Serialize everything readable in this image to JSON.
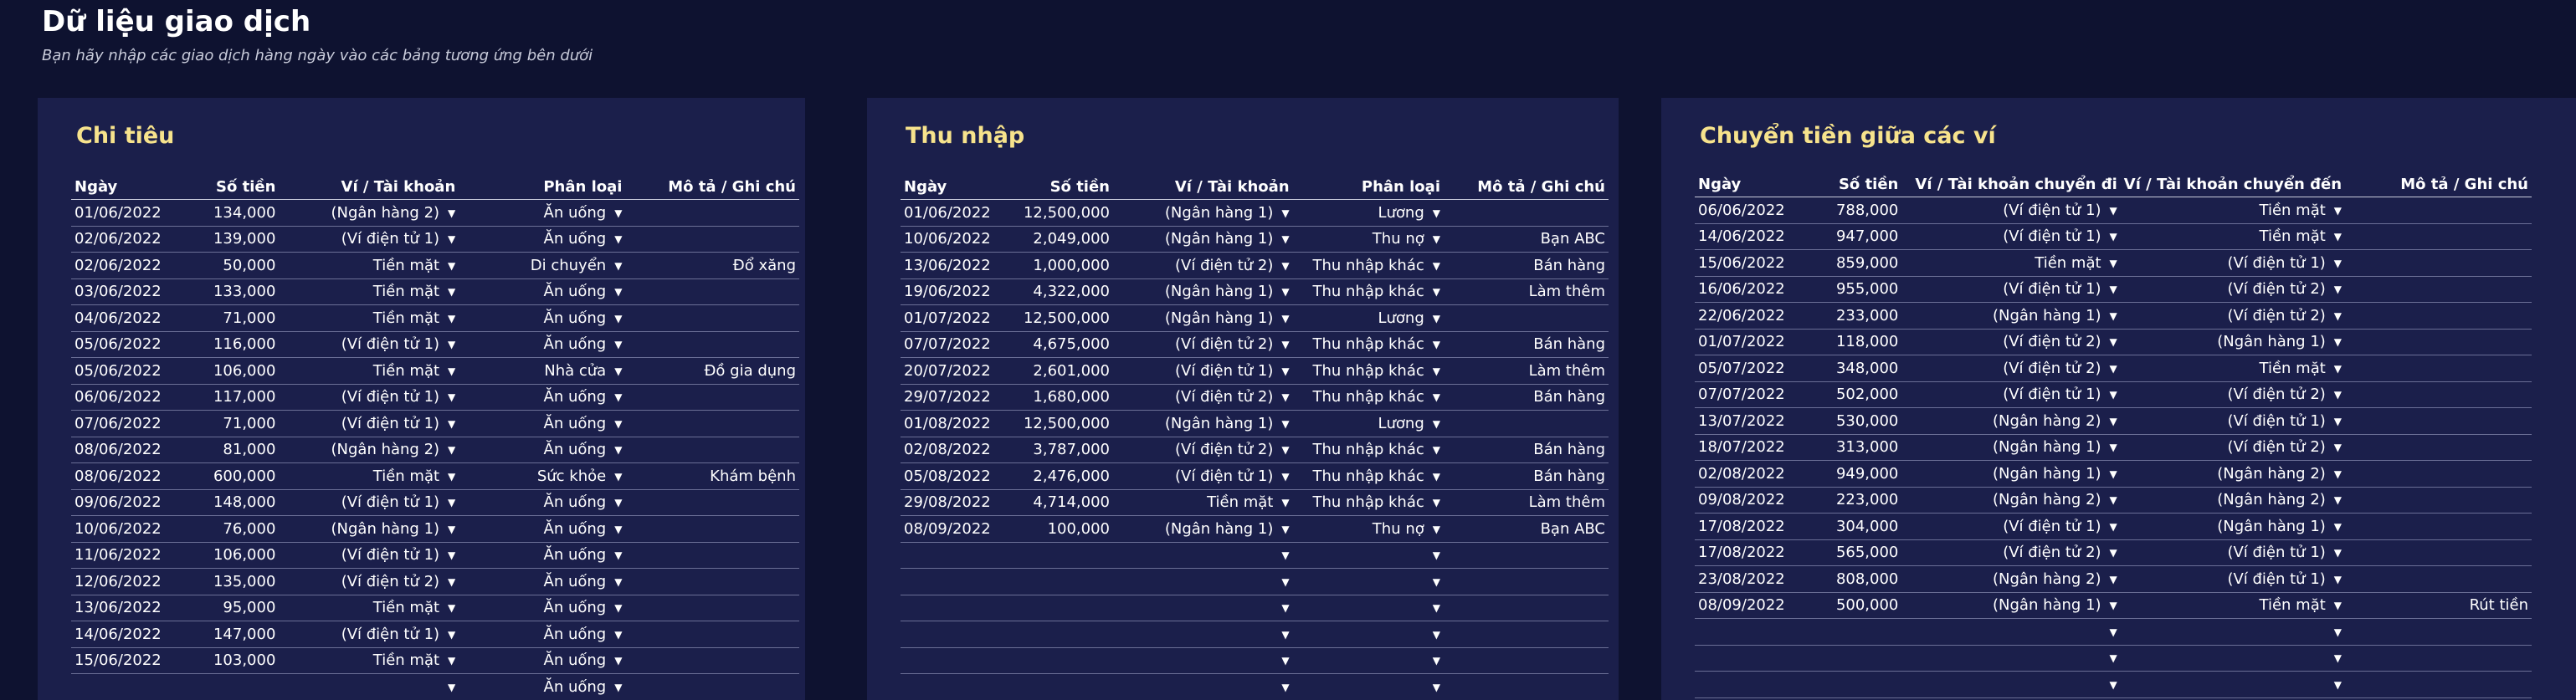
{
  "page": {
    "title": "Dữ liệu giao dịch",
    "subtitle": "Bạn hãy nhập các giao dịch hàng ngày vào các bảng tương ứng bên dưới"
  },
  "icons": {
    "dropdown": "chevron-down-icon"
  },
  "colors": {
    "background": "#0e1230",
    "panel": "#1b1f4b",
    "panel_title": "#f7e38c"
  },
  "expense": {
    "title": "Chi tiêu",
    "headers": [
      "Ngày",
      "Số tiền",
      "Ví / Tài khoản",
      "Phân loại",
      "Mô tả / Ghi chú"
    ],
    "rows": [
      [
        "01/06/2022",
        "134,000",
        "(Ngân hàng 2)",
        "Ăn uống",
        ""
      ],
      [
        "02/06/2022",
        "139,000",
        "(Ví điện tử 1)",
        "Ăn uống",
        ""
      ],
      [
        "02/06/2022",
        "50,000",
        "Tiền mặt",
        "Di chuyển",
        "Đổ xăng"
      ],
      [
        "03/06/2022",
        "133,000",
        "Tiền mặt",
        "Ăn uống",
        ""
      ],
      [
        "04/06/2022",
        "71,000",
        "Tiền mặt",
        "Ăn uống",
        ""
      ],
      [
        "05/06/2022",
        "116,000",
        "(Ví điện tử 1)",
        "Ăn uống",
        ""
      ],
      [
        "05/06/2022",
        "106,000",
        "Tiền mặt",
        "Nhà cửa",
        "Đồ gia dụng"
      ],
      [
        "06/06/2022",
        "117,000",
        "(Ví điện tử 1)",
        "Ăn uống",
        ""
      ],
      [
        "07/06/2022",
        "71,000",
        "(Ví điện tử 1)",
        "Ăn uống",
        ""
      ],
      [
        "08/06/2022",
        "81,000",
        "(Ngân hàng 2)",
        "Ăn uống",
        ""
      ],
      [
        "08/06/2022",
        "600,000",
        "Tiền mặt",
        "Sức khỏe",
        "Khám bệnh"
      ],
      [
        "09/06/2022",
        "148,000",
        "(Ví điện tử 1)",
        "Ăn uống",
        ""
      ],
      [
        "10/06/2022",
        "76,000",
        "(Ngân hàng 1)",
        "Ăn uống",
        ""
      ],
      [
        "11/06/2022",
        "106,000",
        "(Ví điện tử 1)",
        "Ăn uống",
        ""
      ],
      [
        "12/06/2022",
        "135,000",
        "(Ví điện tử 2)",
        "Ăn uống",
        ""
      ],
      [
        "13/06/2022",
        "95,000",
        "Tiền mặt",
        "Ăn uống",
        ""
      ],
      [
        "14/06/2022",
        "147,000",
        "(Ví điện tử 1)",
        "Ăn uống",
        ""
      ],
      [
        "15/06/2022",
        "103,000",
        "Tiền mặt",
        "Ăn uống",
        ""
      ],
      [
        "",
        "",
        "",
        "Ăn uống",
        ""
      ]
    ]
  },
  "income": {
    "title": "Thu nhập",
    "headers": [
      "Ngày",
      "Số tiền",
      "Ví / Tài khoản",
      "Phân loại",
      "Mô tả / Ghi chú"
    ],
    "rows": [
      [
        "01/06/2022",
        "12,500,000",
        "(Ngân hàng 1)",
        "Lương",
        ""
      ],
      [
        "10/06/2022",
        "2,049,000",
        "(Ngân hàng 1)",
        "Thu nợ",
        "Bạn ABC"
      ],
      [
        "13/06/2022",
        "1,000,000",
        "(Ví điện tử 2)",
        "Thu nhập khác",
        "Bán hàng"
      ],
      [
        "19/06/2022",
        "4,322,000",
        "(Ngân hàng 1)",
        "Thu nhập khác",
        "Làm thêm"
      ],
      [
        "01/07/2022",
        "12,500,000",
        "(Ngân hàng 1)",
        "Lương",
        ""
      ],
      [
        "07/07/2022",
        "4,675,000",
        "(Ví điện tử 2)",
        "Thu nhập khác",
        "Bán hàng"
      ],
      [
        "20/07/2022",
        "2,601,000",
        "(Ví điện tử 1)",
        "Thu nhập khác",
        "Làm thêm"
      ],
      [
        "29/07/2022",
        "1,680,000",
        "(Ví điện tử 2)",
        "Thu nhập khác",
        "Bán hàng"
      ],
      [
        "01/08/2022",
        "12,500,000",
        "(Ngân hàng 1)",
        "Lương",
        ""
      ],
      [
        "02/08/2022",
        "3,787,000",
        "(Ví điện tử 2)",
        "Thu nhập khác",
        "Bán hàng"
      ],
      [
        "05/08/2022",
        "2,476,000",
        "(Ví điện tử 1)",
        "Thu nhập khác",
        "Bán hàng"
      ],
      [
        "29/08/2022",
        "4,714,000",
        "Tiền mặt",
        "Thu nhập khác",
        "Làm thêm"
      ],
      [
        "08/09/2022",
        "100,000",
        "(Ngân hàng 1)",
        "Thu nợ",
        "Bạn ABC"
      ],
      [
        "",
        "",
        "",
        "",
        ""
      ],
      [
        "",
        "",
        "",
        "",
        ""
      ],
      [
        "",
        "",
        "",
        "",
        ""
      ],
      [
        "",
        "",
        "",
        "",
        ""
      ],
      [
        "",
        "",
        "",
        "",
        ""
      ],
      [
        "",
        "",
        "",
        "",
        ""
      ]
    ]
  },
  "transfer": {
    "title": "Chuyển tiền giữa các ví",
    "headers": [
      "Ngày",
      "Số tiền",
      "Ví / Tài khoản chuyển đi",
      "Ví / Tài khoản chuyển đến",
      "Mô tả / Ghi chú"
    ],
    "rows": [
      [
        "06/06/2022",
        "788,000",
        "(Ví điện tử 1)",
        "Tiền mặt",
        ""
      ],
      [
        "14/06/2022",
        "947,000",
        "(Ví điện tử 1)",
        "Tiền mặt",
        ""
      ],
      [
        "15/06/2022",
        "859,000",
        "Tiền mặt",
        "(Ví điện tử 1)",
        ""
      ],
      [
        "16/06/2022",
        "955,000",
        "(Ví điện tử 1)",
        "(Ví điện tử 2)",
        ""
      ],
      [
        "22/06/2022",
        "233,000",
        "(Ngân hàng 1)",
        "(Ví điện tử 2)",
        ""
      ],
      [
        "01/07/2022",
        "118,000",
        "(Ví điện tử 2)",
        "(Ngân hàng 1)",
        ""
      ],
      [
        "05/07/2022",
        "348,000",
        "(Ví điện tử 2)",
        "Tiền mặt",
        ""
      ],
      [
        "07/07/2022",
        "502,000",
        "(Ví điện tử 1)",
        "(Ví điện tử 2)",
        ""
      ],
      [
        "13/07/2022",
        "530,000",
        "(Ngân hàng 2)",
        "(Ví điện tử 1)",
        ""
      ],
      [
        "18/07/2022",
        "313,000",
        "(Ngân hàng 1)",
        "(Ví điện tử 2)",
        ""
      ],
      [
        "02/08/2022",
        "949,000",
        "(Ngân hàng 1)",
        "(Ngân hàng 2)",
        ""
      ],
      [
        "09/08/2022",
        "223,000",
        "(Ngân hàng 2)",
        "(Ngân hàng 2)",
        ""
      ],
      [
        "17/08/2022",
        "304,000",
        "(Ví điện tử 1)",
        "(Ngân hàng 1)",
        ""
      ],
      [
        "17/08/2022",
        "565,000",
        "(Ví điện tử 2)",
        "(Ví điện tử 1)",
        ""
      ],
      [
        "23/08/2022",
        "808,000",
        "(Ngân hàng 2)",
        "(Ví điện tử 1)",
        ""
      ],
      [
        "08/09/2022",
        "500,000",
        "(Ngân hàng 1)",
        "Tiền mặt",
        "Rút tiền"
      ],
      [
        "",
        "",
        "",
        "",
        ""
      ],
      [
        "",
        "",
        "",
        "",
        ""
      ],
      [
        "",
        "",
        "",
        "",
        ""
      ],
      [
        "",
        "",
        "",
        "",
        ""
      ]
    ]
  }
}
